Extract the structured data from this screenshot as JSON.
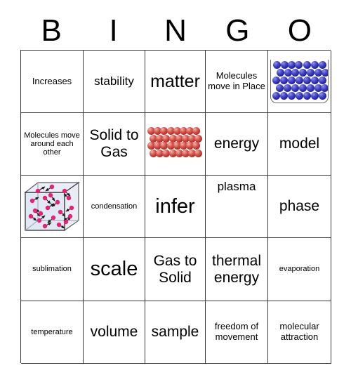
{
  "header": {
    "letters": [
      "B",
      "I",
      "N",
      "G",
      "O"
    ]
  },
  "grid": {
    "columns": 5,
    "rows": 5,
    "cells": [
      [
        {
          "type": "text",
          "text": "Increases",
          "size": "sm"
        },
        {
          "type": "text",
          "text": "stability",
          "size": "md"
        },
        {
          "type": "text",
          "text": "matter",
          "size": "xl"
        },
        {
          "type": "text",
          "text": "Molecules move in Place",
          "size": "sm"
        },
        {
          "type": "image",
          "image": "blue-molecules-in-container",
          "label": "Molecules packed in a container"
        }
      ],
      [
        {
          "type": "text",
          "text": "Molecules move around each other",
          "size": "xs"
        },
        {
          "type": "text",
          "text": "Solid to Gas",
          "size": "lg"
        },
        {
          "type": "image",
          "image": "red-molecule-lattice",
          "label": "Red molecules in a fixed lattice"
        },
        {
          "type": "text",
          "text": "energy",
          "size": "lg"
        },
        {
          "type": "text",
          "text": "model",
          "size": "lg"
        }
      ],
      [
        {
          "type": "image",
          "image": "gas-particles-in-cube",
          "label": "Pink gas particles moving in a cube"
        },
        {
          "type": "text",
          "text": "condensation",
          "size": "xs"
        },
        {
          "type": "text",
          "text": "infer",
          "size": "xxl"
        },
        {
          "type": "text",
          "text": "plasma",
          "size": "md",
          "valign": "top"
        },
        {
          "type": "text",
          "text": "phase",
          "size": "lg"
        }
      ],
      [
        {
          "type": "text",
          "text": "sublimation",
          "size": "xs"
        },
        {
          "type": "text",
          "text": "scale",
          "size": "xxl"
        },
        {
          "type": "text",
          "text": "Gas to Solid",
          "size": "lg"
        },
        {
          "type": "text",
          "text": "thermal energy",
          "size": "lg"
        },
        {
          "type": "text",
          "text": "evaporation",
          "size": "xs"
        }
      ],
      [
        {
          "type": "text",
          "text": "temperature",
          "size": "xs"
        },
        {
          "type": "text",
          "text": "volume",
          "size": "lg"
        },
        {
          "type": "text",
          "text": "sample",
          "size": "lg"
        },
        {
          "type": "text",
          "text": "freedom of movement",
          "size": "sm"
        },
        {
          "type": "text",
          "text": "molecular attraction",
          "size": "sm"
        }
      ]
    ]
  },
  "colors": {
    "grid_line": "#3a3a3a",
    "text": "#000000",
    "background": "#ffffff",
    "molecule_blue": "#2a2cb0",
    "molecule_red": "#c6423a",
    "gas_particle_pink": "#ee1e78",
    "cube_fill": "#dfe9f3"
  }
}
